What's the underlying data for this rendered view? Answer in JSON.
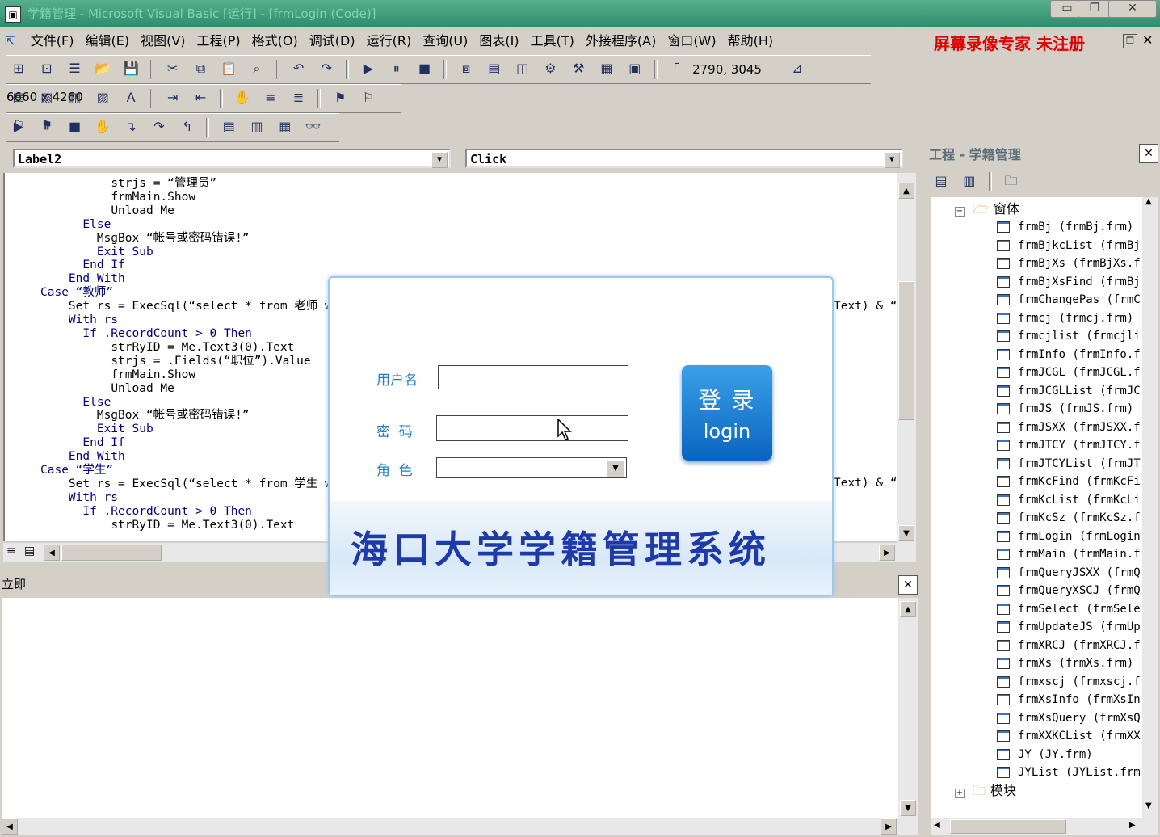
{
  "window": {
    "title": "学籍管理 - Microsoft Visual Basic [运行] - [frmLogin (Code)]"
  },
  "menu": [
    "文件(F)",
    "编辑(E)",
    "视图(V)",
    "工程(P)",
    "格式(O)",
    "调试(D)",
    "运行(R)",
    "查询(U)",
    "图表(I)",
    "工具(T)",
    "外接程序(A)",
    "窗口(W)",
    "帮助(H)"
  ],
  "watermark": "屏幕录像专家 未注册",
  "toolbar": {
    "position": "2790, 3045",
    "size": "6660 x 4260"
  },
  "editor": {
    "object_combo": "Label2",
    "proc_combo": "Click",
    "lines": [
      {
        "indent": 10,
        "text": "strjs = “管理员”"
      },
      {
        "indent": 10,
        "text": "frmMain.Show"
      },
      {
        "indent": 10,
        "text": "Unload Me"
      },
      {
        "indent": 6,
        "text": "Else",
        "kw": true
      },
      {
        "indent": 8,
        "text": "MsgBox “帐号或密码错误!”"
      },
      {
        "indent": 8,
        "text": "Exit Sub",
        "kw": true
      },
      {
        "indent": 6,
        "text": "End If",
        "kw": true
      },
      {
        "indent": 4,
        "text": "End With",
        "kw": true
      },
      {
        "indent": 0,
        "text": "Case “教师”",
        "kw": true
      },
      {
        "indent": 4,
        "text": "Set rs = ExecSql(“select * from 老师 wh"
      },
      {
        "indent": 4,
        "text": "With rs",
        "kw": true
      },
      {
        "indent": 6,
        "text": "If .RecordCount > 0 Then",
        "kw": true
      },
      {
        "indent": 10,
        "text": "strRyID = Me.Text3(0).Text"
      },
      {
        "indent": 10,
        "text": "strjs = .Fields(“职位”).Value"
      },
      {
        "indent": 10,
        "text": "frmMain.Show"
      },
      {
        "indent": 10,
        "text": "Unload Me"
      },
      {
        "indent": 6,
        "text": "Else",
        "kw": true
      },
      {
        "indent": 8,
        "text": "MsgBox “帐号或密码错误!”"
      },
      {
        "indent": 8,
        "text": "Exit Sub",
        "kw": true
      },
      {
        "indent": 6,
        "text": "End If",
        "kw": true
      },
      {
        "indent": 4,
        "text": "End With",
        "kw": true
      },
      {
        "indent": 0,
        "text": "Case “学生”",
        "kw": true
      },
      {
        "indent": 4,
        "text": "Set rs = ExecSql(“select * from 学生 wh"
      },
      {
        "indent": 4,
        "text": "With rs",
        "kw": true
      },
      {
        "indent": 6,
        "text": "If .RecordCount > 0 Then",
        "kw": true
      },
      {
        "indent": 10,
        "text": "strRyID = Me.Text3(0).Text"
      }
    ],
    "overflow_right": [
      "Text) & “",
      "Text) & “"
    ]
  },
  "immediate": {
    "title": "立即"
  },
  "project": {
    "title": "工程 - 学籍管理",
    "forms_folder": "窗体",
    "modules_folder": "模块",
    "items": [
      "frmBj (frmBj.frm)",
      "frmBjkcList (frmBj",
      "frmBjXs (frmBjXs.f",
      "frmBjXsFind (frmBj",
      "frmChangePas (frmC",
      "frmcj (frmcj.frm)",
      "frmcjlist (frmcjli",
      "frmInfo (frmInfo.f",
      "frmJCGL (frmJCGL.f",
      "frmJCGLList (frmJC",
      "frmJS (frmJS.frm)",
      "frmJSXX (frmJSXX.f",
      "frmJTCY (frmJTCY.f",
      "frmJTCYList (frmJT",
      "frmKcFind (frmKcFi",
      "frmKcList (frmKcLi",
      "frmKcSz (frmKcSz.f",
      "frmLogin (frmLogin",
      "frmMain (frmMain.f",
      "frmQueryJSXX (frmQ",
      "frmQueryXSCJ (frmQ",
      "frmSelect (frmSele",
      "frmUpdateJS (frmUp",
      "frmXRCJ (frmXRCJ.f",
      "frmXs (frmXs.frm)",
      "frmxscj (frmxscj.f",
      "frmXsInfo (frmXsIn",
      "frmXsQuery (frmXsQ",
      "frmXXKCList (frmXX",
      "JY (JY.frm)",
      "JYList (JYList.frm"
    ]
  },
  "login": {
    "username_label": "用户名",
    "password_label": "密  码",
    "role_label": "角  色",
    "button_cn": "登 录",
    "button_en": "login",
    "banner": "海口大学学籍管理系统"
  }
}
